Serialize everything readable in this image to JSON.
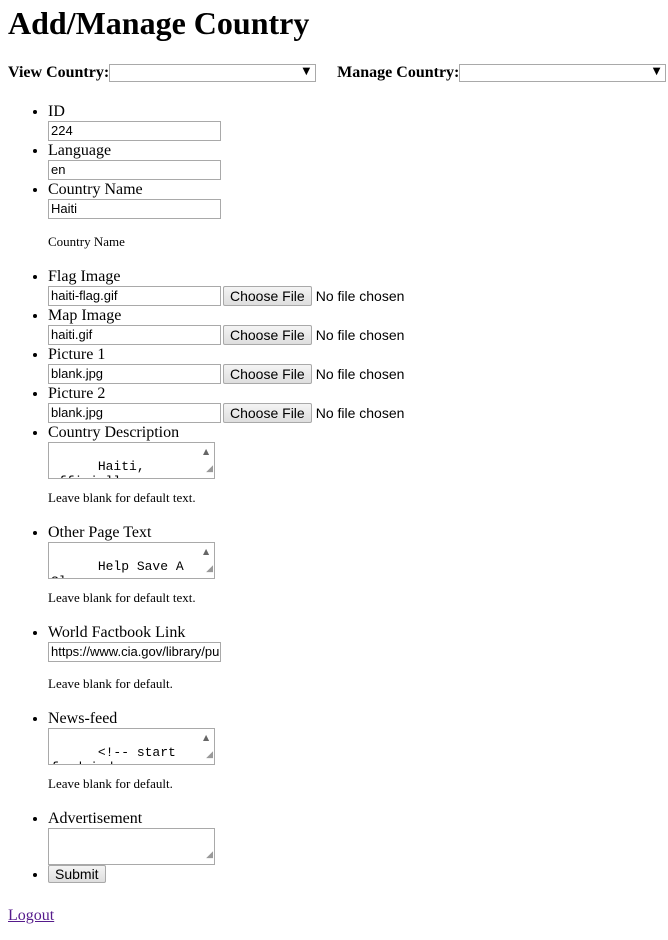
{
  "page": {
    "title": "Add/Manage Country",
    "logout_label": "Logout"
  },
  "selectors": {
    "view_label": "View Country:",
    "view_value": "",
    "manage_label": "Manage Country:",
    "manage_value": ""
  },
  "form": {
    "id": {
      "label": "ID",
      "value": "224"
    },
    "language": {
      "label": "Language",
      "value": "en"
    },
    "country_name": {
      "label": "Country Name",
      "value": "Haiti",
      "help": "Country Name"
    },
    "flag_image": {
      "label": "Flag Image",
      "value": "haiti-flag.gif",
      "button": "Choose File",
      "status": "No file chosen"
    },
    "map_image": {
      "label": "Map Image",
      "value": "haiti.gif",
      "button": "Choose File",
      "status": "No file chosen"
    },
    "picture1": {
      "label": "Picture 1",
      "value": "blank.jpg",
      "button": "Choose File",
      "status": "No file chosen"
    },
    "picture2": {
      "label": "Picture 2",
      "value": "blank.jpg",
      "button": "Choose File",
      "status": "No file chosen"
    },
    "country_description": {
      "label": "Country Description",
      "value": "Haiti, officially\nthe Republic of",
      "help": "Leave blank for default text."
    },
    "other_page_text": {
      "label": "Other Page Text",
      "value": "Help Save A Slave\ninform and educate",
      "help": "Leave blank for default text."
    },
    "world_factbook": {
      "label": "World Factbook Link",
      "value": "https://www.cia.gov/library/pu",
      "help": "Leave blank for default."
    },
    "news_feed": {
      "label": "News-feed",
      "value": "<!-- start feedwind\ncode --><script",
      "help": "Leave blank for default."
    },
    "advertisement": {
      "label": "Advertisement",
      "value": ""
    },
    "submit_label": "Submit"
  },
  "icons": {
    "dropdown": "chevron-down-icon",
    "scroll_up": "scroll-up-icon",
    "resize": "resize-grip-icon"
  }
}
